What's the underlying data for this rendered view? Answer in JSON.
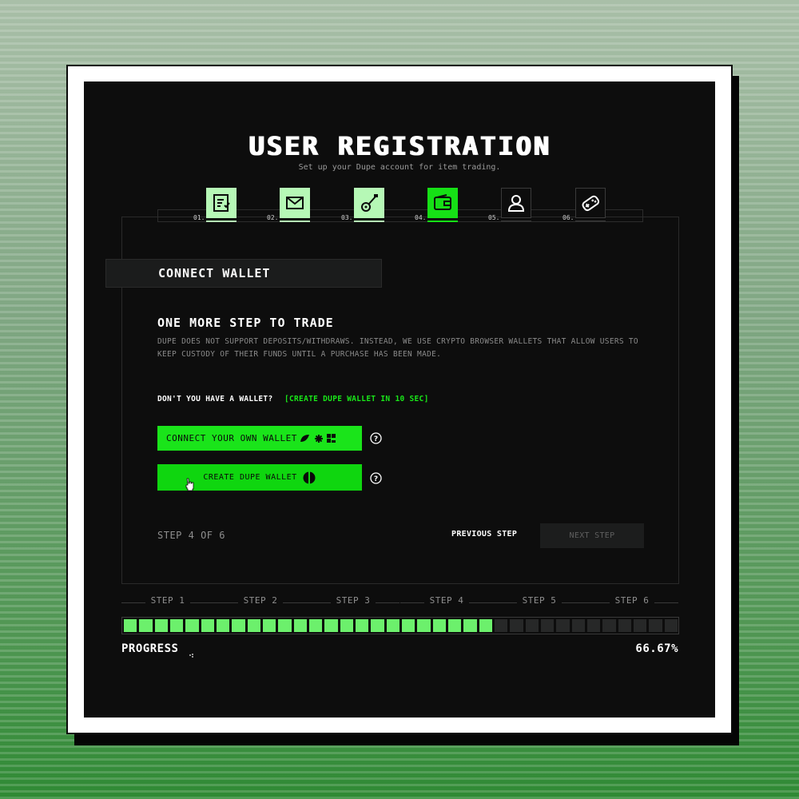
{
  "header": {
    "title": "USER REGISTRATION",
    "subtitle": "Set up your Dupe account for item trading."
  },
  "steps": [
    {
      "number": "01.",
      "icon": "document-icon",
      "state": "done"
    },
    {
      "number": "02.",
      "icon": "mail-icon",
      "state": "done"
    },
    {
      "number": "03.",
      "icon": "guitar-icon",
      "state": "done"
    },
    {
      "number": "04.",
      "icon": "wallet-icon",
      "state": "active"
    },
    {
      "number": "05.",
      "icon": "user-icon",
      "state": "todo"
    },
    {
      "number": "06.",
      "icon": "gamepad-icon",
      "state": "todo"
    }
  ],
  "section": {
    "tab_label": "CONNECT WALLET",
    "heading": "ONE MORE STEP TO TRADE",
    "description": "DUPE DOES NOT SUPPORT DEPOSITS/WITHDRAWS. INSTEAD, WE USE CRYPTO BROWSER WALLETS THAT ALLOW USERS TO KEEP CUSTODY OF THEIR FUNDS UNTIL A PURCHASE HAS BEEN MADE.",
    "wallet_question": "DON'T YOU HAVE A WALLET?",
    "wallet_link": "[CREATE DUPE WALLET IN 10 SEC]"
  },
  "buttons": {
    "connect_label": "CONNECT YOUR OWN WALLET",
    "create_label": "CREATE DUPE WALLET"
  },
  "navigation": {
    "step_counter": "STEP 4 OF 6",
    "previous_label": "PREVIOUS STEP",
    "next_label": "NEXT STEP"
  },
  "progress": {
    "step_labels": [
      "STEP 1",
      "STEP 2",
      "STEP 3",
      "STEP 4",
      "STEP 5",
      "STEP 6"
    ],
    "label": "PROGRESS",
    "value_text": "66.67%",
    "fraction": 0.6667,
    "total_segments": 36
  },
  "colors": {
    "accent": "#16e016",
    "done": "#b6f8b6",
    "segment_on": "#6cf06c",
    "segment_off": "#272828"
  }
}
